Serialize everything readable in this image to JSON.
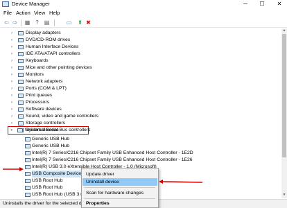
{
  "window": {
    "title": "Device Manager",
    "minimize": "─",
    "maximize": "☐",
    "close": "✕"
  },
  "menu": [
    "File",
    "Action",
    "View",
    "Help"
  ],
  "toolbar": {
    "icons": [
      "back-icon",
      "forward-icon",
      "properties-icon",
      "help-icon",
      "show-hidden-icon",
      "monitor-icon",
      "update-driver-icon",
      "uninstall-icon"
    ],
    "glyphs": [
      "⇦",
      "⇨",
      "▦",
      "?",
      "▤",
      "▭",
      "⬆",
      "✖"
    ]
  },
  "tree": {
    "categories": [
      "Display adapters",
      "DVD/CD-ROM drives",
      "Human Interface Devices",
      "IDE ATA/ATAPI controllers",
      "Keyboards",
      "Mice and other pointing devices",
      "Monitors",
      "Network adapters",
      "Ports (COM & LPT)",
      "Print queues",
      "Processors",
      "Software devices",
      "Sound, video and game controllers",
      "Storage controllers",
      "System devices"
    ],
    "usb_category": "Universal Serial Bus controllers",
    "usb_devices": [
      "Generic USB Hub",
      "Generic USB Hub",
      "Intel(R) 7 Series/C216 Chipset Family USB Enhanced Host Controller - 1E2D",
      "Intel(R) 7 Series/C216 Chipset Family USB Enhanced Host Controller - 1E26",
      "Intel(R) USB 3.0 eXtensible Host Controller - 1.0 (Microsoft)",
      "USB Composite Device",
      "USB Root Hub",
      "USB Root Hub",
      "USB Root Hub (USB 3.0)"
    ],
    "collapsed_chevron": "›",
    "expanded_chevron": "⌄"
  },
  "context_menu": {
    "items": [
      "Update driver",
      "Uninstall device",
      "Scan for hardware changes",
      "Properties"
    ],
    "highlighted": "Uninstall device"
  },
  "status": "Uninstalls the driver for the selected device.",
  "colors": {
    "annotation": "#d00000",
    "highlight": "#91c9f7",
    "selection": "#cce4f7"
  }
}
